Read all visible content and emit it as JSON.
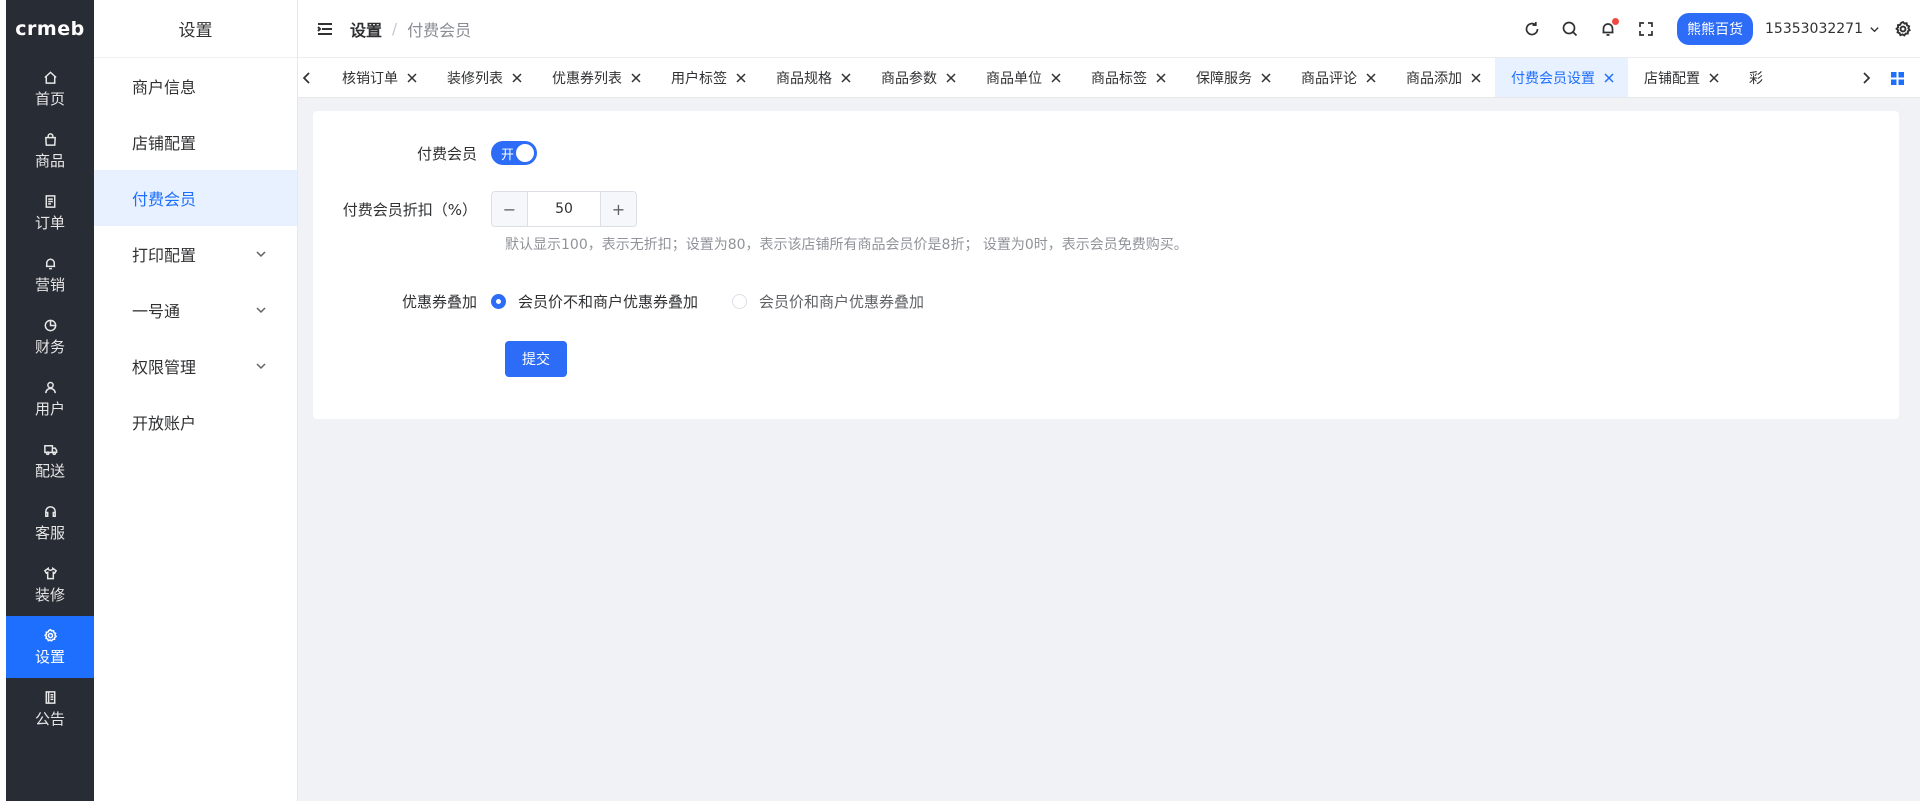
{
  "app": {
    "logo_text": "crmeb"
  },
  "rail": {
    "items": [
      {
        "label": "首页",
        "icon": "home-icon"
      },
      {
        "label": "商品",
        "icon": "bag-icon"
      },
      {
        "label": "订单",
        "icon": "order-icon"
      },
      {
        "label": "营销",
        "icon": "bell-icon"
      },
      {
        "label": "财务",
        "icon": "pie-icon"
      },
      {
        "label": "用户",
        "icon": "user-icon"
      },
      {
        "label": "配送",
        "icon": "truck-icon"
      },
      {
        "label": "客服",
        "icon": "headset-icon"
      },
      {
        "label": "装修",
        "icon": "shirt-icon"
      },
      {
        "label": "设置",
        "icon": "gear-icon",
        "active": true
      },
      {
        "label": "公告",
        "icon": "notice-icon"
      }
    ]
  },
  "submenu": {
    "title": "设置",
    "items": [
      {
        "label": "商户信息"
      },
      {
        "label": "店铺配置"
      },
      {
        "label": "付费会员",
        "active": true
      },
      {
        "label": "打印配置",
        "has_children": true
      },
      {
        "label": "一号通",
        "has_children": true
      },
      {
        "label": "权限管理",
        "has_children": true
      },
      {
        "label": "开放账户"
      }
    ]
  },
  "header": {
    "breadcrumb_root": "设置",
    "breadcrumb_sep": "/",
    "breadcrumb_current": "付费会员",
    "store_name": "熊熊百货",
    "user_phone": "15353032271"
  },
  "tabs": [
    {
      "label": "核销订单"
    },
    {
      "label": "装修列表"
    },
    {
      "label": "优惠券列表"
    },
    {
      "label": "用户标签"
    },
    {
      "label": "商品规格"
    },
    {
      "label": "商品参数"
    },
    {
      "label": "商品单位"
    },
    {
      "label": "商品标签"
    },
    {
      "label": "保障服务"
    },
    {
      "label": "商品评论"
    },
    {
      "label": "商品添加"
    },
    {
      "label": "付费会员设置",
      "active": true
    },
    {
      "label": "店铺配置"
    },
    {
      "label": "彩"
    }
  ],
  "form": {
    "member_label": "付费会员",
    "member_switch_text": "开",
    "member_enabled": true,
    "discount_label": "付费会员折扣（%）",
    "discount_minus": "−",
    "discount_plus": "+",
    "discount_value": "50",
    "discount_hint": "默认显示100，表示无折扣；设置为80，表示该店铺所有商品会员价是8折； 设置为0时，表示会员免费购买。",
    "coupon_label": "优惠券叠加",
    "coupon_options": [
      {
        "label": "会员价不和商户优惠券叠加",
        "checked": true
      },
      {
        "label": "会员价和商户优惠券叠加",
        "checked": false
      }
    ],
    "submit_label": "提交"
  },
  "colors": {
    "primary": "#2d6cf6",
    "rail_bg": "#282c35",
    "active_bg": "#e8f1ff"
  }
}
